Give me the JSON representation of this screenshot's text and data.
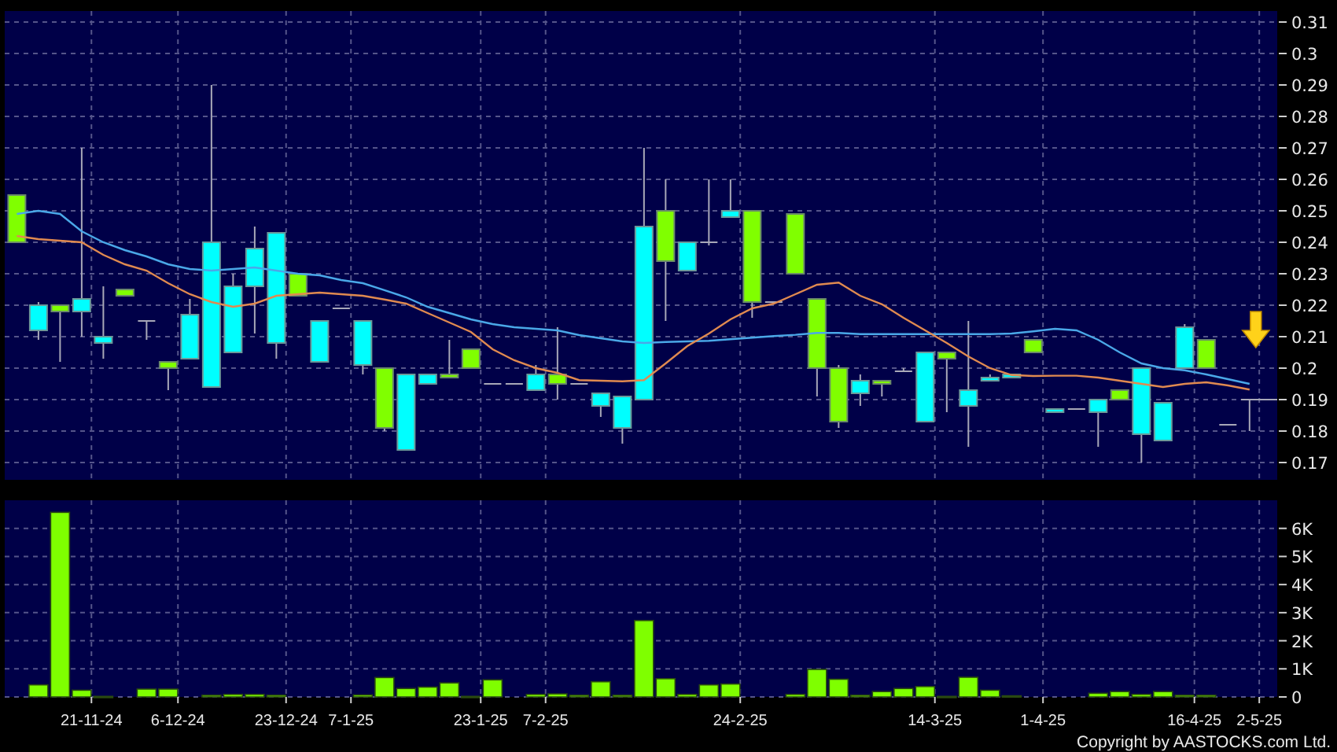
{
  "price_panel": {
    "chart_data": {
      "type": "candlestick",
      "grid": true,
      "ylim": [
        0.1645,
        0.3135
      ],
      "yticks": [
        {
          "value": 0.17,
          "label": "0.17"
        },
        {
          "value": 0.18,
          "label": "0.18"
        },
        {
          "value": 0.19,
          "label": "0.19"
        },
        {
          "value": 0.2,
          "label": "0.2"
        },
        {
          "value": 0.21,
          "label": "0.21"
        },
        {
          "value": 0.22,
          "label": "0.22"
        },
        {
          "value": 0.23,
          "label": "0.23"
        },
        {
          "value": 0.24,
          "label": "0.24"
        },
        {
          "value": 0.25,
          "label": "0.25"
        },
        {
          "value": 0.26,
          "label": "0.26"
        },
        {
          "value": 0.27,
          "label": "0.27"
        },
        {
          "value": 0.28,
          "label": "0.28"
        },
        {
          "value": 0.29,
          "label": "0.29"
        },
        {
          "value": 0.3,
          "label": "0.3"
        },
        {
          "value": 0.31,
          "label": "0.31"
        }
      ],
      "ohlc": [
        [
          0.255,
          0.255,
          0.24,
          0.24
        ],
        [
          0.212,
          0.221,
          0.209,
          0.22
        ],
        [
          0.22,
          0.22,
          0.202,
          0.218
        ],
        [
          0.218,
          0.27,
          0.21,
          0.222
        ],
        [
          0.208,
          0.226,
          0.203,
          0.21
        ],
        [
          0.225,
          0.225,
          0.223,
          0.223
        ],
        [
          0.215,
          0.215,
          0.209,
          0.215
        ],
        [
          0.202,
          0.202,
          0.193,
          0.2
        ],
        [
          0.203,
          0.222,
          0.203,
          0.217
        ],
        [
          0.194,
          0.29,
          0.194,
          0.24
        ],
        [
          0.205,
          0.23,
          0.205,
          0.226
        ],
        [
          0.226,
          0.245,
          0.211,
          0.238
        ],
        [
          0.208,
          0.243,
          0.203,
          0.243
        ],
        [
          0.23,
          0.23,
          0.223,
          0.223
        ],
        [
          0.202,
          0.215,
          0.202,
          0.215
        ],
        [
          0.219,
          0.219,
          0.219,
          0.219
        ],
        [
          0.201,
          0.215,
          0.198,
          0.215
        ],
        [
          0.2,
          0.2,
          0.18,
          0.181
        ],
        [
          0.174,
          0.198,
          0.174,
          0.198
        ],
        [
          0.195,
          0.198,
          0.195,
          0.198
        ],
        [
          0.198,
          0.209,
          0.197,
          0.197
        ],
        [
          0.206,
          0.206,
          0.2,
          0.2
        ],
        [
          0.195,
          0.195,
          0.195,
          0.195
        ],
        [
          0.195,
          0.195,
          0.195,
          0.195
        ],
        [
          0.193,
          0.201,
          0.193,
          0.198
        ],
        [
          0.198,
          0.213,
          0.19,
          0.195
        ],
        [
          0.195,
          0.195,
          0.195,
          0.195
        ],
        [
          0.188,
          0.192,
          0.1845,
          0.192
        ],
        [
          0.181,
          0.191,
          0.176,
          0.191
        ],
        [
          0.19,
          0.27,
          0.19,
          0.245
        ],
        [
          0.25,
          0.26,
          0.215,
          0.234
        ],
        [
          0.231,
          0.24,
          0.231,
          0.24
        ],
        [
          0.24,
          0.26,
          0.239,
          0.24
        ],
        [
          0.248,
          0.26,
          0.248,
          0.25
        ],
        [
          0.25,
          0.25,
          0.216,
          0.221
        ],
        [
          0.221,
          0.221,
          0.221,
          0.221
        ],
        [
          0.249,
          0.249,
          0.23,
          0.23
        ],
        [
          0.222,
          0.222,
          0.191,
          0.2
        ],
        [
          0.2,
          0.201,
          0.181,
          0.183
        ],
        [
          0.192,
          0.198,
          0.188,
          0.196
        ],
        [
          0.196,
          0.196,
          0.191,
          0.195
        ],
        [
          0.199,
          0.2,
          0.199,
          0.199
        ],
        [
          0.183,
          0.205,
          0.183,
          0.205
        ],
        [
          0.205,
          0.205,
          0.186,
          0.203
        ],
        [
          0.188,
          0.215,
          0.175,
          0.193
        ],
        [
          0.196,
          0.198,
          0.196,
          0.197
        ],
        [
          0.197,
          0.198,
          0.197,
          0.198
        ],
        [
          0.209,
          0.209,
          0.205,
          0.205
        ],
        [
          0.186,
          0.187,
          0.186,
          0.187
        ],
        [
          0.187,
          0.187,
          0.187,
          0.187
        ],
        [
          0.186,
          0.19,
          0.175,
          0.19
        ],
        [
          0.193,
          0.193,
          0.19,
          0.19
        ],
        [
          0.179,
          0.2,
          0.17,
          0.2
        ],
        [
          0.177,
          0.189,
          0.177,
          0.189
        ],
        [
          0.2,
          0.214,
          0.2,
          0.213
        ],
        [
          0.209,
          0.209,
          0.2,
          0.2
        ],
        [
          0.182,
          0.182,
          0.182,
          0.182
        ],
        [
          0.19,
          0.19,
          0.18,
          0.19
        ]
      ],
      "series": [
        {
          "type": "line",
          "color": "#4aa8e8",
          "values": [
            0.249,
            0.25,
            0.249,
            0.2435,
            0.24,
            0.2375,
            0.2355,
            0.233,
            0.2315,
            0.231,
            0.2315,
            0.232,
            0.231,
            0.23,
            0.2295,
            0.228,
            0.227,
            0.2248,
            0.2225,
            0.2195,
            0.2175,
            0.2155,
            0.214,
            0.213,
            0.2125,
            0.212,
            0.2105,
            0.2095,
            0.2085,
            0.208,
            0.2083,
            0.2085,
            0.2087,
            0.2092,
            0.2097,
            0.2102,
            0.2106,
            0.2112,
            0.2112,
            0.2108,
            0.2108,
            0.2108,
            0.2108,
            0.2108,
            0.2108,
            0.2108,
            0.211,
            0.2117,
            0.2125,
            0.212,
            0.209,
            0.205,
            0.2015,
            0.2,
            0.1993,
            0.198,
            0.1965,
            0.195
          ]
        },
        {
          "type": "line",
          "color": "#e08a50",
          "values": [
            0.242,
            0.241,
            0.2405,
            0.24,
            0.236,
            0.233,
            0.231,
            0.227,
            0.2235,
            0.221,
            0.2195,
            0.2205,
            0.223,
            0.2235,
            0.224,
            0.2235,
            0.223,
            0.2218,
            0.2205,
            0.2175,
            0.2145,
            0.2115,
            0.206,
            0.2025,
            0.2,
            0.1985,
            0.1962,
            0.196,
            0.1958,
            0.1962,
            0.2015,
            0.207,
            0.211,
            0.2155,
            0.219,
            0.2205,
            0.2235,
            0.2265,
            0.2272,
            0.223,
            0.2203,
            0.216,
            0.212,
            0.208,
            0.2037,
            0.2,
            0.1978,
            0.1975,
            0.1976,
            0.1976,
            0.197,
            0.196,
            0.195,
            0.194,
            0.195,
            0.1955,
            0.1945,
            0.1932
          ]
        }
      ]
    }
  },
  "volume_panel": {
    "chart_data": {
      "type": "bar",
      "grid": true,
      "ylim": [
        0,
        7
      ],
      "yticks": [
        {
          "value": 0,
          "label": "0"
        },
        {
          "value": 1,
          "label": "1K"
        },
        {
          "value": 2,
          "label": "2K"
        },
        {
          "value": 3,
          "label": "3K"
        },
        {
          "value": 4,
          "label": "4K"
        },
        {
          "value": 5,
          "label": "5K"
        },
        {
          "value": 6,
          "label": "6K"
        }
      ],
      "categories": [
        null,
        null,
        null,
        "21-11-24",
        null,
        null,
        null,
        "6-12-24",
        null,
        null,
        null,
        null,
        "23-12-24",
        null,
        null,
        "7-1-25",
        null,
        null,
        null,
        null,
        null,
        "23-1-25",
        null,
        null,
        "7-2-25",
        null,
        null,
        null,
        null,
        null,
        null,
        null,
        null,
        "24-2-25",
        null,
        null,
        null,
        null,
        null,
        null,
        null,
        null,
        "14-3-25",
        null,
        null,
        null,
        null,
        "1-4-25",
        null,
        null,
        null,
        null,
        null,
        null,
        "16-4-25",
        null,
        null,
        "2-5-25"
      ],
      "series": [
        {
          "color": "#7fff00",
          "values": [
            null,
            0.43,
            6.57,
            0.24,
            0.02,
            null,
            0.28,
            0.28,
            null,
            0.06,
            0.09,
            0.09,
            0.06,
            null,
            null,
            null,
            0.07,
            0.69,
            0.3,
            0.35,
            0.5,
            0.02,
            0.61,
            null,
            0.09,
            0.11,
            0.06,
            0.54,
            0.06,
            2.72,
            0.65,
            0.09,
            0.43,
            0.46,
            null,
            null,
            0.09,
            0.98,
            0.63,
            0.06,
            0.19,
            0.3,
            0.37,
            0.02,
            0.7,
            0.24,
            0.04,
            null,
            null,
            null,
            0.13,
            0.19,
            0.09,
            0.19,
            0.06,
            0.06,
            null,
            null
          ]
        }
      ]
    }
  },
  "copyright": "Copyright by AASTOCKS.com Ltd."
}
